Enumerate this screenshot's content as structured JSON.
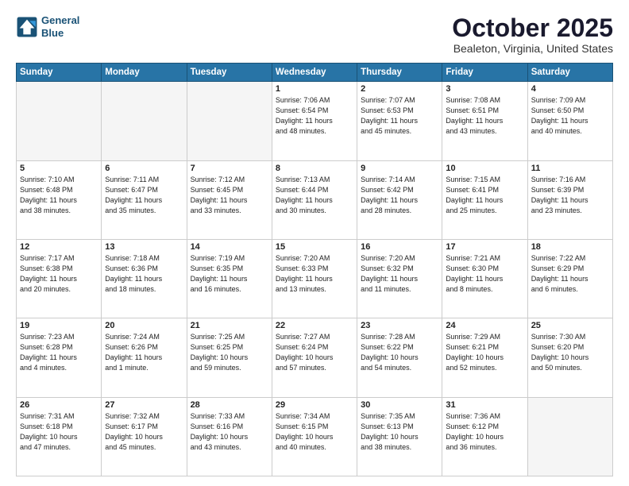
{
  "header": {
    "logo_line1": "General",
    "logo_line2": "Blue",
    "month": "October 2025",
    "location": "Bealeton, Virginia, United States"
  },
  "days_of_week": [
    "Sunday",
    "Monday",
    "Tuesday",
    "Wednesday",
    "Thursday",
    "Friday",
    "Saturday"
  ],
  "weeks": [
    [
      {
        "day": "",
        "info": ""
      },
      {
        "day": "",
        "info": ""
      },
      {
        "day": "",
        "info": ""
      },
      {
        "day": "1",
        "info": "Sunrise: 7:06 AM\nSunset: 6:54 PM\nDaylight: 11 hours\nand 48 minutes."
      },
      {
        "day": "2",
        "info": "Sunrise: 7:07 AM\nSunset: 6:53 PM\nDaylight: 11 hours\nand 45 minutes."
      },
      {
        "day": "3",
        "info": "Sunrise: 7:08 AM\nSunset: 6:51 PM\nDaylight: 11 hours\nand 43 minutes."
      },
      {
        "day": "4",
        "info": "Sunrise: 7:09 AM\nSunset: 6:50 PM\nDaylight: 11 hours\nand 40 minutes."
      }
    ],
    [
      {
        "day": "5",
        "info": "Sunrise: 7:10 AM\nSunset: 6:48 PM\nDaylight: 11 hours\nand 38 minutes."
      },
      {
        "day": "6",
        "info": "Sunrise: 7:11 AM\nSunset: 6:47 PM\nDaylight: 11 hours\nand 35 minutes."
      },
      {
        "day": "7",
        "info": "Sunrise: 7:12 AM\nSunset: 6:45 PM\nDaylight: 11 hours\nand 33 minutes."
      },
      {
        "day": "8",
        "info": "Sunrise: 7:13 AM\nSunset: 6:44 PM\nDaylight: 11 hours\nand 30 minutes."
      },
      {
        "day": "9",
        "info": "Sunrise: 7:14 AM\nSunset: 6:42 PM\nDaylight: 11 hours\nand 28 minutes."
      },
      {
        "day": "10",
        "info": "Sunrise: 7:15 AM\nSunset: 6:41 PM\nDaylight: 11 hours\nand 25 minutes."
      },
      {
        "day": "11",
        "info": "Sunrise: 7:16 AM\nSunset: 6:39 PM\nDaylight: 11 hours\nand 23 minutes."
      }
    ],
    [
      {
        "day": "12",
        "info": "Sunrise: 7:17 AM\nSunset: 6:38 PM\nDaylight: 11 hours\nand 20 minutes."
      },
      {
        "day": "13",
        "info": "Sunrise: 7:18 AM\nSunset: 6:36 PM\nDaylight: 11 hours\nand 18 minutes."
      },
      {
        "day": "14",
        "info": "Sunrise: 7:19 AM\nSunset: 6:35 PM\nDaylight: 11 hours\nand 16 minutes."
      },
      {
        "day": "15",
        "info": "Sunrise: 7:20 AM\nSunset: 6:33 PM\nDaylight: 11 hours\nand 13 minutes."
      },
      {
        "day": "16",
        "info": "Sunrise: 7:20 AM\nSunset: 6:32 PM\nDaylight: 11 hours\nand 11 minutes."
      },
      {
        "day": "17",
        "info": "Sunrise: 7:21 AM\nSunset: 6:30 PM\nDaylight: 11 hours\nand 8 minutes."
      },
      {
        "day": "18",
        "info": "Sunrise: 7:22 AM\nSunset: 6:29 PM\nDaylight: 11 hours\nand 6 minutes."
      }
    ],
    [
      {
        "day": "19",
        "info": "Sunrise: 7:23 AM\nSunset: 6:28 PM\nDaylight: 11 hours\nand 4 minutes."
      },
      {
        "day": "20",
        "info": "Sunrise: 7:24 AM\nSunset: 6:26 PM\nDaylight: 11 hours\nand 1 minute."
      },
      {
        "day": "21",
        "info": "Sunrise: 7:25 AM\nSunset: 6:25 PM\nDaylight: 10 hours\nand 59 minutes."
      },
      {
        "day": "22",
        "info": "Sunrise: 7:27 AM\nSunset: 6:24 PM\nDaylight: 10 hours\nand 57 minutes."
      },
      {
        "day": "23",
        "info": "Sunrise: 7:28 AM\nSunset: 6:22 PM\nDaylight: 10 hours\nand 54 minutes."
      },
      {
        "day": "24",
        "info": "Sunrise: 7:29 AM\nSunset: 6:21 PM\nDaylight: 10 hours\nand 52 minutes."
      },
      {
        "day": "25",
        "info": "Sunrise: 7:30 AM\nSunset: 6:20 PM\nDaylight: 10 hours\nand 50 minutes."
      }
    ],
    [
      {
        "day": "26",
        "info": "Sunrise: 7:31 AM\nSunset: 6:18 PM\nDaylight: 10 hours\nand 47 minutes."
      },
      {
        "day": "27",
        "info": "Sunrise: 7:32 AM\nSunset: 6:17 PM\nDaylight: 10 hours\nand 45 minutes."
      },
      {
        "day": "28",
        "info": "Sunrise: 7:33 AM\nSunset: 6:16 PM\nDaylight: 10 hours\nand 43 minutes."
      },
      {
        "day": "29",
        "info": "Sunrise: 7:34 AM\nSunset: 6:15 PM\nDaylight: 10 hours\nand 40 minutes."
      },
      {
        "day": "30",
        "info": "Sunrise: 7:35 AM\nSunset: 6:13 PM\nDaylight: 10 hours\nand 38 minutes."
      },
      {
        "day": "31",
        "info": "Sunrise: 7:36 AM\nSunset: 6:12 PM\nDaylight: 10 hours\nand 36 minutes."
      },
      {
        "day": "",
        "info": ""
      }
    ]
  ]
}
